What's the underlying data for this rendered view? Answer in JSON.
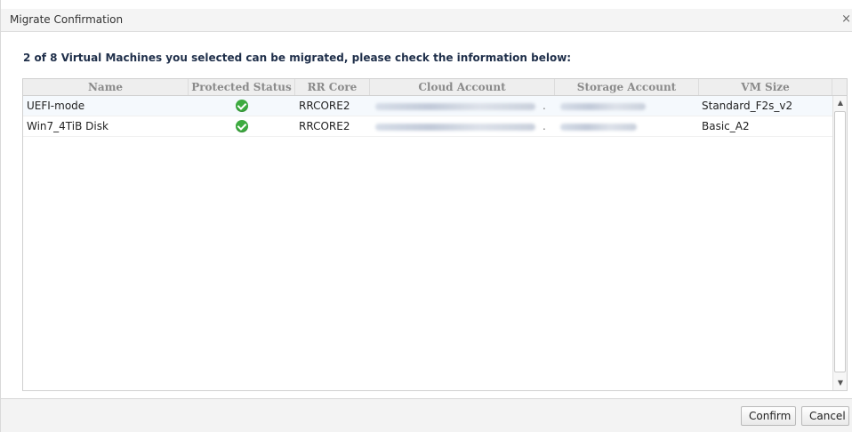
{
  "dialog": {
    "title": "Migrate Confirmation",
    "close_glyph": "×"
  },
  "message": "2 of 8 Virtual Machines you selected can be migrated, please check the information below:",
  "grid": {
    "columns": [
      "Name",
      "Protected Status",
      "RR Core",
      "Cloud Account",
      "Storage Account",
      "VM Size"
    ],
    "rows": [
      {
        "name": "UEFI-mode",
        "protected_status": "check-icon",
        "rr_core": "RRCORE2",
        "vm_size": "Standard_F2s_v2"
      },
      {
        "name": "Win7_4TiB Disk",
        "protected_status": "check-icon",
        "rr_core": "RRCORE2",
        "vm_size": "Basic_A2"
      }
    ]
  },
  "scrollbar": {
    "up_glyph": "▲",
    "down_glyph": "▼"
  },
  "footer": {
    "confirm_label": "Confirm",
    "cancel_label": "Cancel"
  },
  "colors": {
    "status_ok": "#3cab3f",
    "header_text": "#8a8a8a",
    "message_text": "#1f2f4a"
  }
}
